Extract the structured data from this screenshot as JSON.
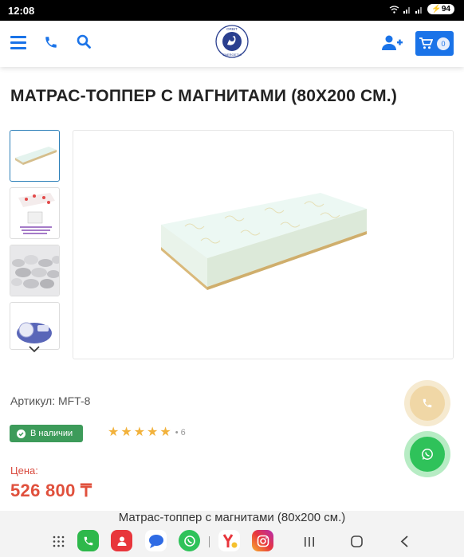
{
  "status_bar": {
    "time": "12:08",
    "battery": "94"
  },
  "header": {
    "logo_text_top": "ORBIT",
    "logo_text_bottom": "ENERGETIA",
    "cart_count": "0"
  },
  "product": {
    "title": "МАТРАС-ТОППЕР С МАГНИТАМИ (80Х200 СМ.)",
    "sku": "Артикул: MFT-8",
    "stock_label": "В наличии",
    "rating_stars": 5,
    "rating_count": "6",
    "price_label": "Цена:",
    "price": "526 800 ₸"
  },
  "bottom_bar": {
    "page_title": "Матрас-топпер с магнитами (80x200 см.)"
  },
  "colors": {
    "accent": "#1a73e8",
    "stock_green": "#3d9b5a",
    "price_red": "#e0503c",
    "star": "#f2b23c",
    "whatsapp": "#2fc25a"
  },
  "icons": [
    "menu-icon",
    "phone-icon",
    "search-icon",
    "add-user-icon",
    "cart-icon",
    "check-icon",
    "chevron-down-icon",
    "whatsapp-icon"
  ]
}
